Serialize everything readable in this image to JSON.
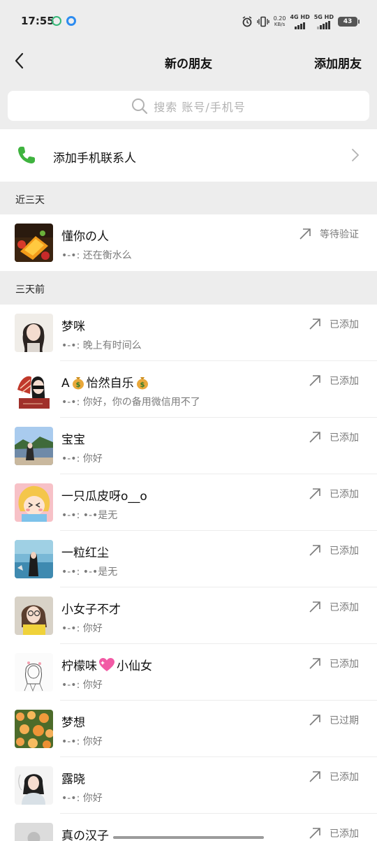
{
  "status_bar": {
    "time": "17:55",
    "net_speed_value": "0.20",
    "net_speed_unit": "KB/s",
    "sim1_label": "4G HD",
    "sim2_label": "5G HD",
    "battery": "43"
  },
  "nav": {
    "title": "新の朋友",
    "action": "添加朋友"
  },
  "search": {
    "placeholder": "搜索  账号/手机号"
  },
  "phone_contacts": {
    "label": "添加手机联系人",
    "icon_color": "#3fb33f"
  },
  "sections": {
    "recent": "近三天",
    "older": "三天前"
  },
  "recent_items": [
    {
      "name": "懂你の人",
      "message": "•-•: 还在衡水么",
      "status": "等待验证"
    }
  ],
  "older_items": [
    {
      "name": "梦咪",
      "message": "•-•: 晚上有时间么",
      "status": "已添加"
    },
    {
      "name_prefix": "A",
      "name_middle": "怡然自乐",
      "message": "•-•: 你好，你の备用微信用不了",
      "status": "已添加"
    },
    {
      "name": "宝宝",
      "message": "•-•: 你好",
      "status": "已添加"
    },
    {
      "name": "一只瓜皮呀o__o",
      "message": "•-•: •-•是无",
      "status": "已添加"
    },
    {
      "name": "一粒红尘",
      "message": "•-•: •-•是无",
      "status": "已添加"
    },
    {
      "name": "小女子不才",
      "message": "•-•: 你好",
      "status": "已添加"
    },
    {
      "name_prefix": "柠檬味",
      "name_suffix": "小仙女",
      "message": "•-•: 你好",
      "status": "已添加"
    },
    {
      "name": "梦想",
      "message": "•-•: 你好",
      "status": "已过期"
    },
    {
      "name": "露晓",
      "message": "•-•: 你好",
      "status": "已添加"
    },
    {
      "name": "真の汉子",
      "message": "",
      "status": "已添加"
    }
  ],
  "colors": {
    "background": "#ededed",
    "card": "#ffffff",
    "secondary_text": "#7b7b7b"
  }
}
